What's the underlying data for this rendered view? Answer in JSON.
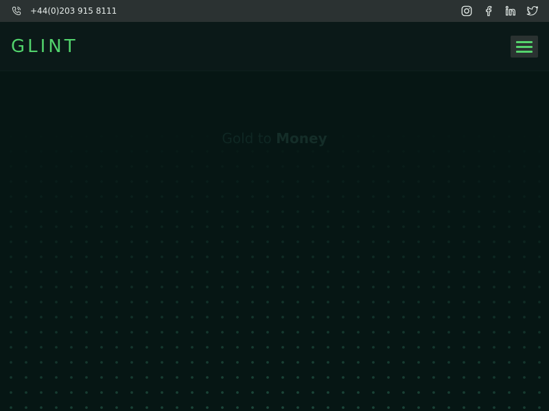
{
  "topbar": {
    "phone": "+44(0)203 915 8111",
    "phone_icon": "phone-icon",
    "social_icons": [
      "instagram-icon",
      "facebook-icon",
      "linkedin-icon",
      "twitter-icon"
    ]
  },
  "header": {
    "logo": "GLINT",
    "menu_icon": "hamburger-menu-icon"
  },
  "hero": {
    "title_part1": "Gold to",
    "title_part2": "Money"
  },
  "colors": {
    "topbar_bg": "#2b3232",
    "header_bg": "#0b1918",
    "page_bg": "#061614",
    "accent": "#52d36c",
    "dot": "#1d4a3c"
  }
}
